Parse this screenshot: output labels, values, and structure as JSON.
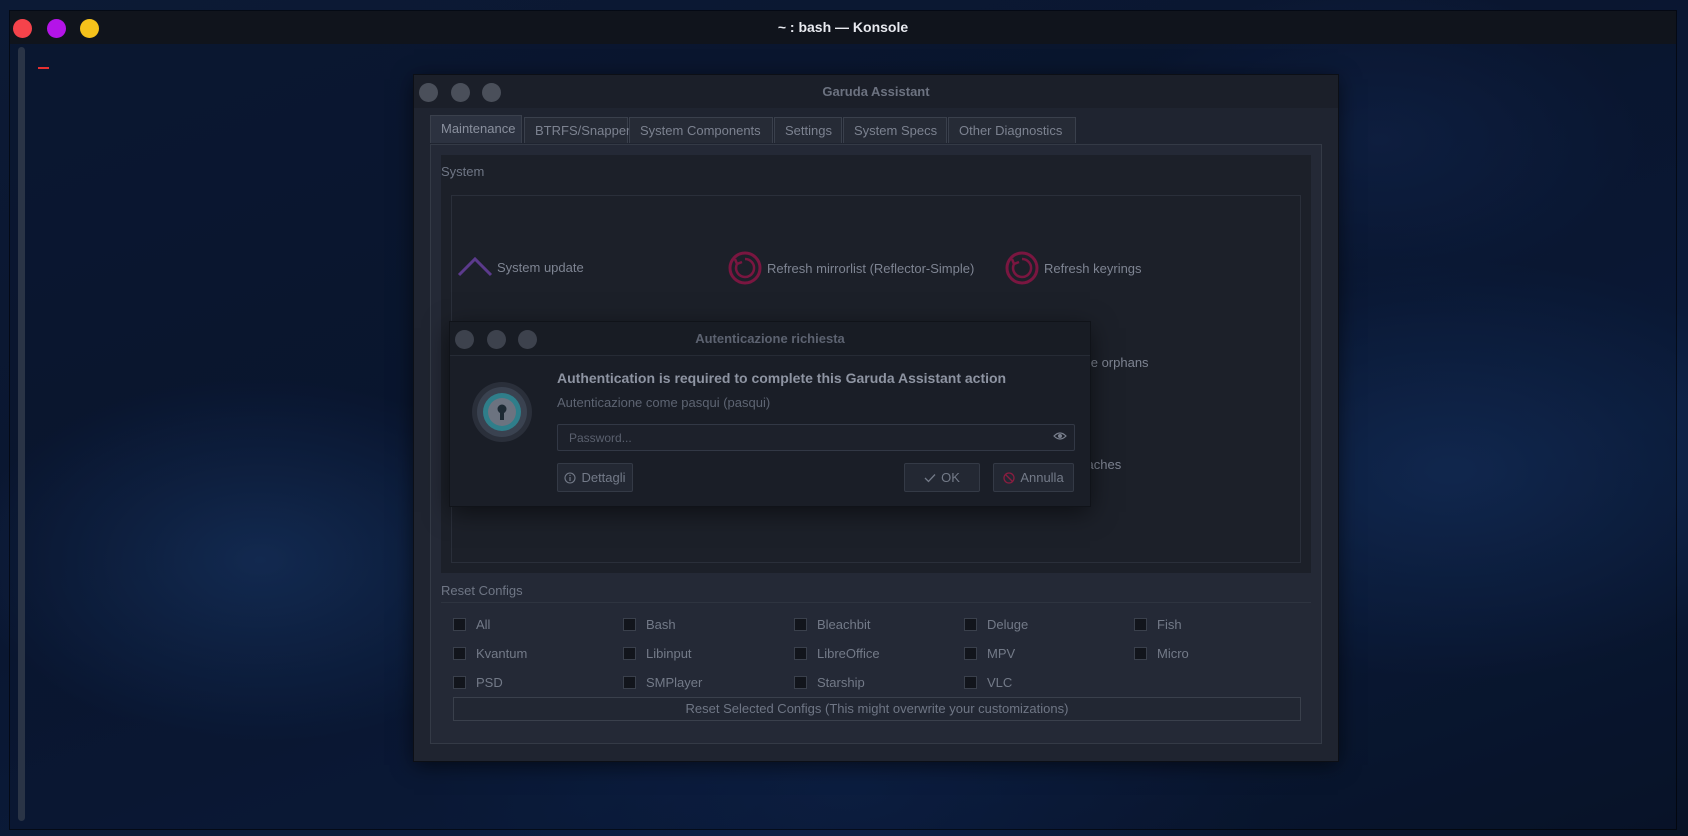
{
  "konsole": {
    "title": "~ : bash — Konsole",
    "buttons": [
      "close",
      "minimize",
      "maximize"
    ],
    "colors": {
      "close": "#f5434b",
      "minimize": "#b414e8",
      "maximize": "#f5c21b"
    }
  },
  "garuda": {
    "title": "Garuda Assistant",
    "tabs": [
      {
        "label": "Maintenance",
        "active": true
      },
      {
        "label": "BTRFS/Snapper"
      },
      {
        "label": "System Components"
      },
      {
        "label": "Settings"
      },
      {
        "label": "System Specs"
      },
      {
        "label": "Other Diagnostics"
      }
    ],
    "system": {
      "title": "System",
      "actions": [
        {
          "label": "System update",
          "icon": "chevron-up-icon"
        },
        {
          "label": "Refresh mirrorlist (Reflector-Simple)",
          "icon": "refresh-icon"
        },
        {
          "label": "Refresh keyrings",
          "icon": "refresh-icon"
        },
        {
          "label": "ove orphans"
        },
        {
          "label": "caches"
        }
      ]
    },
    "reset": {
      "title": "Reset Configs",
      "options": [
        "All",
        "Bash",
        "Bleachbit",
        "Deluge",
        "Fish",
        "Kvantum",
        "Libinput",
        "LibreOffice",
        "MPV",
        "Micro",
        "PSD",
        "SMPlayer",
        "Starship",
        "VLC"
      ],
      "button": "Reset Selected Configs (This might overwrite your customizations)"
    }
  },
  "auth": {
    "title": "Autenticazione richiesta",
    "heading": "Authentication is required to complete this Garuda Assistant action",
    "subtitle": "Autenticazione come pasqui (pasqui)",
    "password_placeholder": "Password...",
    "details_label": "Dettagli",
    "ok_label": "OK",
    "cancel_label": "Annulla",
    "icon": "lock-icon"
  }
}
